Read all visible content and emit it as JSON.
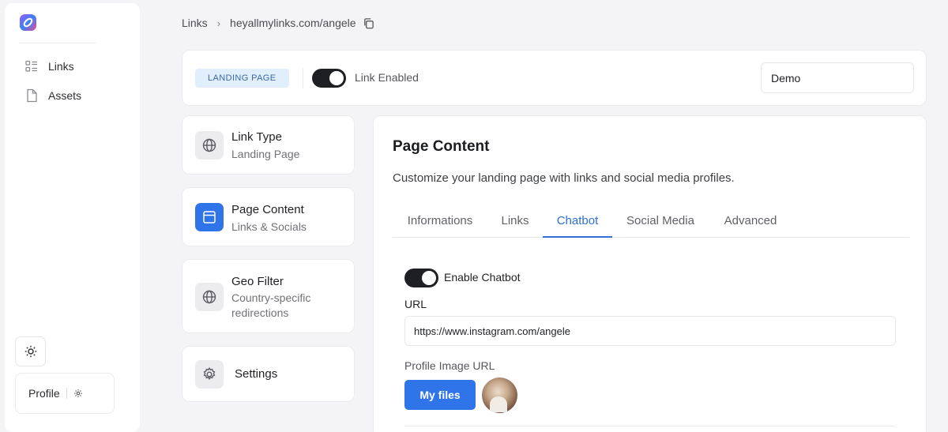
{
  "sidebar": {
    "items": [
      {
        "label": "Links",
        "icon": "list-icon"
      },
      {
        "label": "Assets",
        "icon": "file-icon"
      }
    ],
    "theme_icon": "sun-icon",
    "profile_label": "Profile",
    "profile_icon": "gear-icon"
  },
  "breadcrumb": {
    "root": "Links",
    "current": "heyallmylinks.com/angele",
    "copy_icon": "copy-icon"
  },
  "topbar": {
    "badge": "LANDING PAGE",
    "toggle_label": "Link Enabled",
    "toggle_on": true,
    "name_value": "Demo"
  },
  "cards": [
    {
      "title": "Link Type",
      "subtitle": "Landing Page",
      "icon": "globe-icon",
      "active": false
    },
    {
      "title": "Page Content",
      "subtitle": "Links & Socials",
      "icon": "window-icon",
      "active": true
    },
    {
      "title": "Geo Filter",
      "subtitle": "Country-specific redirections",
      "icon": "globe-icon",
      "active": false
    },
    {
      "title": "Settings",
      "subtitle": "",
      "icon": "gear-icon",
      "active": false
    }
  ],
  "main": {
    "title": "Page Content",
    "description": "Customize your landing page with links and social media profiles.",
    "tabs": [
      {
        "label": "Informations"
      },
      {
        "label": "Links"
      },
      {
        "label": "Chatbot"
      },
      {
        "label": "Social Media"
      },
      {
        "label": "Advanced"
      }
    ],
    "active_tab": "Chatbot",
    "chatbot": {
      "enable_label": "Enable Chatbot",
      "enabled": true,
      "url_label": "URL",
      "url_value": "https://www.instagram.com/angele",
      "image_label": "Profile Image URL",
      "files_button": "My files"
    }
  },
  "colors": {
    "accent": "#2f74e8",
    "badge_bg": "#e1eefb",
    "toggle_on": "#1e1f22"
  }
}
